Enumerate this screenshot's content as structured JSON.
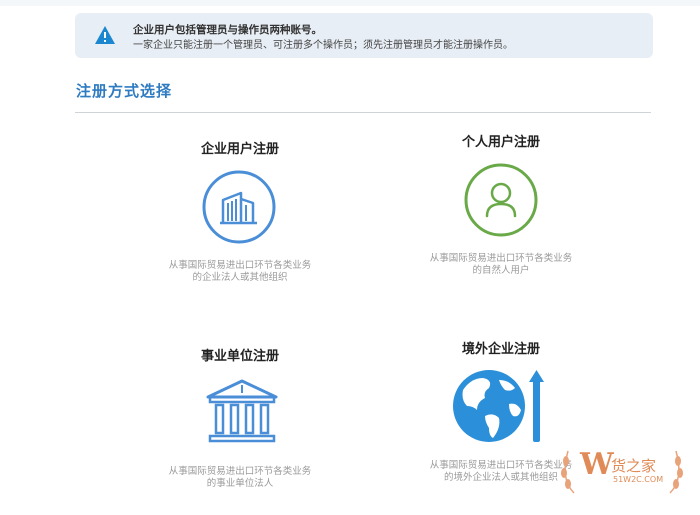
{
  "notice": {
    "title": "企业用户包括管理员与操作员两种账号。",
    "text": "一家企业只能注册一个管理员、可注册多个操作员；须先注册管理员才能注册操作员。",
    "icon": "warning-icon"
  },
  "section": {
    "title": "注册方式选择"
  },
  "options": [
    {
      "title": "企业用户注册",
      "desc_line1": "从事国际贸易进出口环节各类业务",
      "desc_line2": "的企业法人或其他组织",
      "icon": "building-icon"
    },
    {
      "title": "个人用户注册",
      "desc_line1": "从事国际贸易进出口环节各类业务",
      "desc_line2": "的自然人用户",
      "icon": "person-icon"
    },
    {
      "title": "事业单位注册",
      "desc_line1": "从事国际贸易进出口环节各类业务",
      "desc_line2": "的事业单位法人",
      "icon": "institution-icon"
    },
    {
      "title": "境外企业注册",
      "desc_line1": "从事国际贸易进出口环节各类业务",
      "desc_line2": "的境外企业法人或其他组织",
      "icon": "globe-icon"
    }
  ],
  "watermark": {
    "letter": "W",
    "brand": "货之家",
    "url": "51W2C.COM"
  },
  "colors": {
    "accent": "#2f7bc1",
    "icon_blue": "#4a8ed8",
    "icon_green": "#69a948",
    "notice_bg": "#e8eef5",
    "watermark": "#e08b57"
  }
}
